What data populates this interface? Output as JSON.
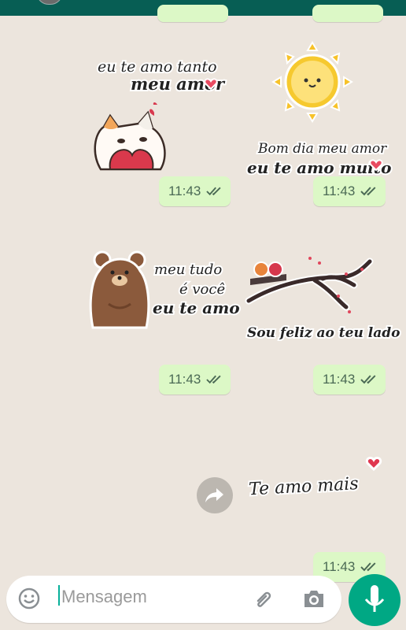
{
  "header": {
    "avatar_icon": "contact-avatar"
  },
  "messages": [
    {
      "id": "sticker-1",
      "type": "sticker",
      "caption_lines": [
        "eu te amo tanto",
        "meu amor"
      ],
      "image": "cat-holding-heart",
      "time": "11:43",
      "status_icon": "double-check-icon"
    },
    {
      "id": "sticker-2",
      "type": "sticker",
      "caption_lines": [
        "Bom dia meu amor",
        "eu te amo muito"
      ],
      "image": "smiling-sun",
      "time": "11:43",
      "status_icon": "double-check-icon"
    },
    {
      "id": "sticker-3",
      "type": "sticker",
      "caption_lines": [
        "meu tudo",
        "é você",
        "eu te amo"
      ],
      "image": "brown-bear",
      "time": "11:43",
      "status_icon": "double-check-icon"
    },
    {
      "id": "sticker-4",
      "type": "sticker",
      "caption_lines": [
        "Sou feliz ao teu lado"
      ],
      "image": "birds-on-branch",
      "time": "11:43",
      "status_icon": "double-check-icon"
    },
    {
      "id": "sticker-5",
      "type": "sticker",
      "caption_lines": [
        "Te amo mais"
      ],
      "image": "heart",
      "time": "11:43",
      "status_icon": "double-check-icon"
    }
  ],
  "composer": {
    "placeholder": "Mensagem",
    "emoji_icon": "emoji-icon",
    "attach_icon": "paperclip-icon",
    "camera_icon": "camera-icon",
    "mic_icon": "microphone-icon"
  },
  "forward_icon": "forward-icon",
  "colors": {
    "chat_background": "#ece5dd",
    "outgoing_bubble": "#dcf8c6",
    "header": "#075e54",
    "accent": "#00a884",
    "tick": "#4b6a55"
  }
}
